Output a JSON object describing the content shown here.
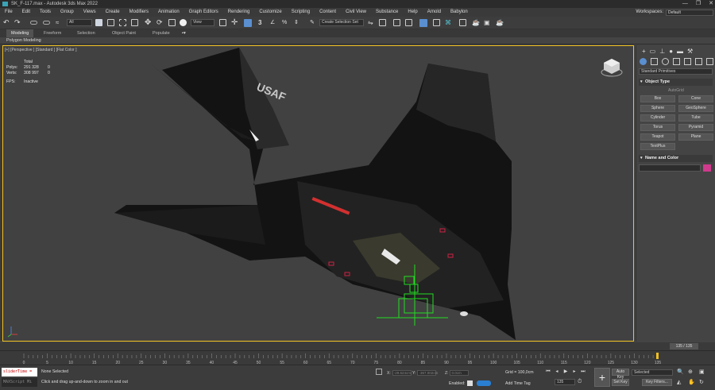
{
  "window": {
    "title": "SK_F-117.max - Autodesk 3ds Max 2022",
    "controls": [
      "—",
      "❐",
      "✕"
    ]
  },
  "menubar": {
    "items": [
      "File",
      "Edit",
      "Tools",
      "Group",
      "Views",
      "Create",
      "Modifiers",
      "Animation",
      "Graph Editors",
      "Rendering",
      "Customize",
      "Scripting",
      "Content",
      "Civil View",
      "Substance",
      "Help",
      "Arnold",
      "Babylon"
    ],
    "workspace_label": "Workspaces:",
    "workspace_value": "Default"
  },
  "toolbar": {
    "filter_value": "All",
    "refcoord_value": "View",
    "selection_set_placeholder": "Create Selection Set"
  },
  "ribbon": {
    "tabs": [
      "Modeling",
      "Freeform",
      "Selection",
      "Object Paint",
      "Populate"
    ],
    "active_tab": "Modeling",
    "sub_label": "Polygon Modeling"
  },
  "viewport": {
    "label": "[+] [Perspective ] [Standard ] [Flat Color ]",
    "stats": {
      "header": "Total",
      "polys_label": "Polys:",
      "polys_value": "291 328",
      "polys_sel": "0",
      "verts_label": "Verts:",
      "verts_value": "308 997",
      "verts_sel": "0",
      "fps_label": "FPS:",
      "fps_value": "Inactive"
    },
    "decal_text": "USAF"
  },
  "command_panel": {
    "dropdown": "Standard Primitives",
    "object_type_title": "Object Type",
    "autogrid": "AutoGrid",
    "buttons": [
      "Box",
      "Cone",
      "Sphere",
      "GeoSphere",
      "Cylinder",
      "Tube",
      "Torus",
      "Pyramid",
      "Teapot",
      "Plane",
      "TextPlus"
    ],
    "name_color_title": "Name and Color",
    "object_color": "#d03a8c"
  },
  "timeline": {
    "slider_text": "135 / 135",
    "ticks": [
      "0",
      "5",
      "10",
      "15",
      "20",
      "25",
      "30",
      "35",
      "40",
      "45",
      "50",
      "55",
      "60",
      "65",
      "70",
      "75",
      "80",
      "85",
      "90",
      "95",
      "100",
      "105",
      "110",
      "115",
      "120",
      "125",
      "130",
      "135"
    ]
  },
  "status": {
    "maxscript_line": "sliderTime = 1(",
    "maxscript_placeholder": "MAXScript Mi",
    "selection_text": "None Selected",
    "prompt_text": "Click and drag up-and-down to zoom in and out",
    "x_label": "X:",
    "x_value": "-29.624cm",
    "y_label": "Y:",
    "y_value": "-367.002cm",
    "z_label": "Z:",
    "z_value": "0.0cm",
    "grid_text": "Grid = 100,0cm",
    "enabled_label": "Enabled:",
    "add_time_tag": "Add Time Tag",
    "frame_value": "135",
    "auto_key": "Auto Key",
    "set_key": "Set Key",
    "selected_value": "Selected",
    "key_filters": "Key Filters..."
  },
  "colors": {
    "viewport_border": "#f0c020",
    "accent_blue": "#5a8fd0",
    "helper_green": "#22dd22"
  }
}
